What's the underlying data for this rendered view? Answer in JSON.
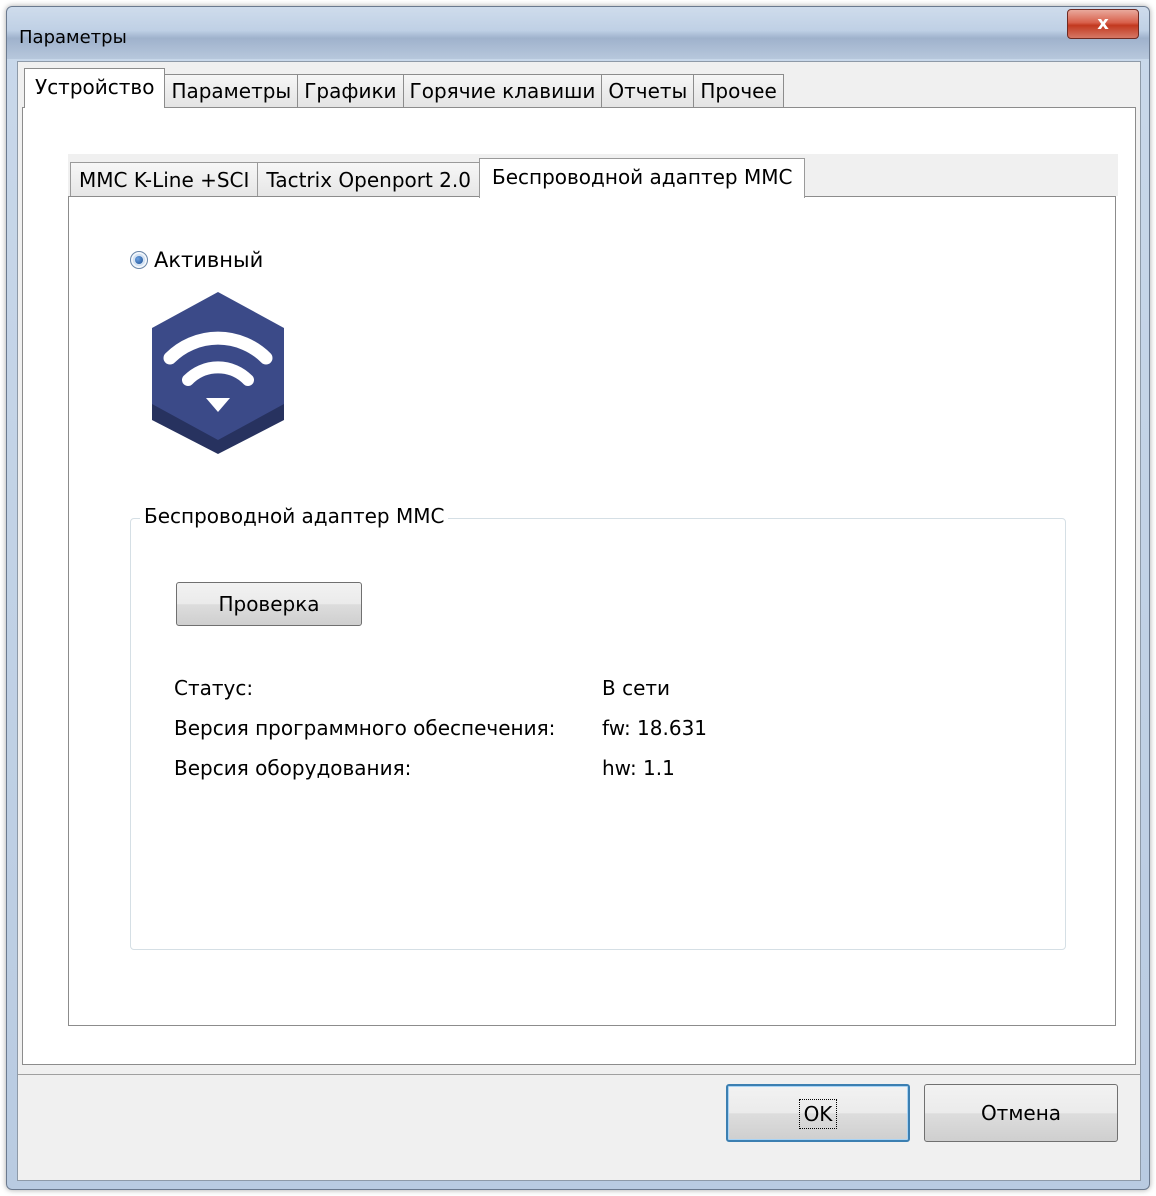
{
  "window": {
    "title": "Параметры",
    "close_label": "x"
  },
  "tabs": [
    "Устройство",
    "Параметры",
    "Графики",
    "Горячие клавиши",
    "Отчеты",
    "Прочее"
  ],
  "inner_tabs": [
    "MMC K-Line +SCI",
    "Tactrix Openport 2.0",
    "Беспроводной адаптер MMC"
  ],
  "device": {
    "active_label": "Активный",
    "icon": "wifi-hexagon-icon",
    "group_title": "Беспроводной адаптер MMC",
    "check_button": "Проверка",
    "status_label": "Статус:",
    "status_value": "В сети",
    "fw_label": "Версия программного обеспечения:",
    "fw_value": "fw: 18.631",
    "hw_label": "Версия оборудования:",
    "hw_value": "hw: 1.1"
  },
  "buttons": {
    "ok": "OK",
    "cancel": "Отмена"
  },
  "colors": {
    "logo": "#3b4a88",
    "logo_shadow": "#27325f"
  }
}
